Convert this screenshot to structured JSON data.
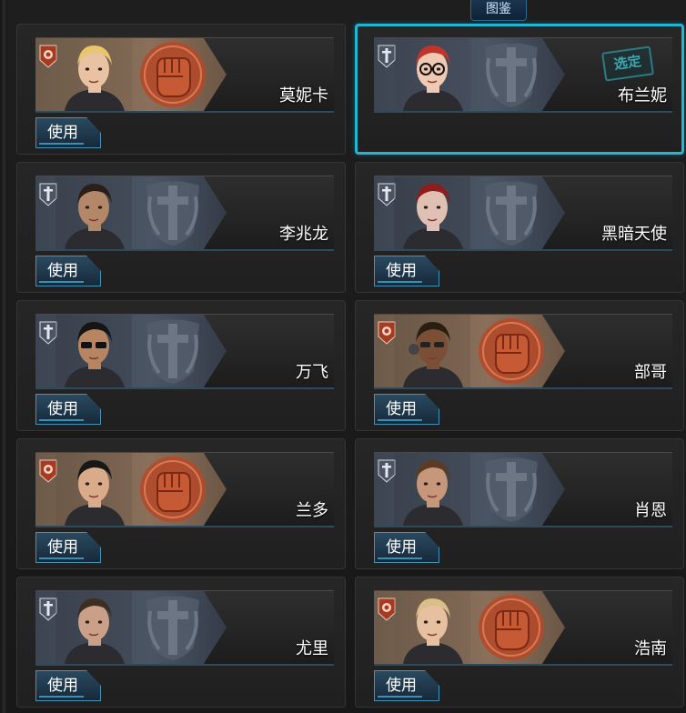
{
  "header": {
    "tab_label": "图鉴"
  },
  "colors": {
    "selected_border": "#20b7d4",
    "fist_faction": "#b34a2a",
    "shield_faction": "#9aa4b0"
  },
  "characters": [
    {
      "name": "莫妮卡",
      "faction": "fist",
      "portrait_icon": "blonde-female-portrait",
      "button_label": "使用",
      "selected": false
    },
    {
      "name": "布兰妮",
      "faction": "shield",
      "portrait_icon": "redhead-glasses-portrait",
      "button_label": "",
      "selected": true,
      "selected_stamp": "选定"
    },
    {
      "name": "李兆龙",
      "faction": "shield",
      "portrait_icon": "male-soldier-portrait",
      "button_label": "使用",
      "selected": false
    },
    {
      "name": "黑暗天使",
      "faction": "shield",
      "portrait_icon": "red-hair-female-portrait",
      "button_label": "使用",
      "selected": false
    },
    {
      "name": "万飞",
      "faction": "shield",
      "portrait_icon": "sunglasses-male-portrait",
      "button_label": "使用",
      "selected": false
    },
    {
      "name": "部哥",
      "faction": "fist",
      "portrait_icon": "dreadlocks-male-portrait",
      "button_label": "使用",
      "selected": false
    },
    {
      "name": "兰多",
      "faction": "fist",
      "portrait_icon": "dark-hair-male-portrait",
      "button_label": "使用",
      "selected": false
    },
    {
      "name": "肖恩",
      "faction": "shield",
      "portrait_icon": "brown-hair-male-portrait",
      "button_label": "使用",
      "selected": false
    },
    {
      "name": "尤里",
      "faction": "shield",
      "portrait_icon": "short-hair-male-portrait",
      "button_label": "使用",
      "selected": false
    },
    {
      "name": "浩南",
      "faction": "fist",
      "portrait_icon": "blond-male-portrait",
      "button_label": "使用",
      "selected": false
    }
  ]
}
